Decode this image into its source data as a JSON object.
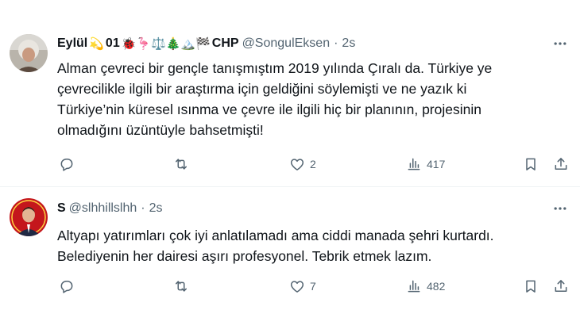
{
  "tweets": [
    {
      "display_name": "Eylül",
      "name_suffix": "01",
      "emoji_before": "💫",
      "emoji_after": "🐞🦩⚖️🎄🏔️🏁",
      "party": "CHP",
      "handle": "@SongulEksen",
      "separator": "·",
      "time": "2s",
      "text": "Alman çevreci bir gençle tanışmıştım 2019 yılında Çıralı da. Türkiye ye\nçevrecilikle ilgili bir araştırma için geldiğini söylemişti ve ne yazık ki\nTürkiye’nin  küresel ısınma ve çevre ile ilgili hiç bir planının, projesinin\nolmadığını üzüntüyle bahsetmişti!",
      "reply_count": "",
      "retweet_count": "",
      "like_count": "2",
      "view_count": "417"
    },
    {
      "display_name": "S",
      "handle": "@slhhillslhh",
      "separator": "·",
      "time": "2s",
      "text": "Altyapı yatırımları çok iyi anlatılamadı ama ciddi manada şehri kurtardı.\nBelediyenin her dairesi aşırı profesyonel. Tebrik etmek lazım.",
      "reply_count": "",
      "retweet_count": "",
      "like_count": "7",
      "view_count": "482"
    }
  ],
  "icons": {
    "reply": "reply-icon",
    "retweet": "retweet-icon",
    "like": "heart-icon",
    "views": "views-icon",
    "bookmark": "bookmark-icon",
    "share": "share-icon",
    "more": "more-icon"
  },
  "colors": {
    "text": "#0f1419",
    "secondary": "#536471",
    "divider": "#eff3f4"
  }
}
